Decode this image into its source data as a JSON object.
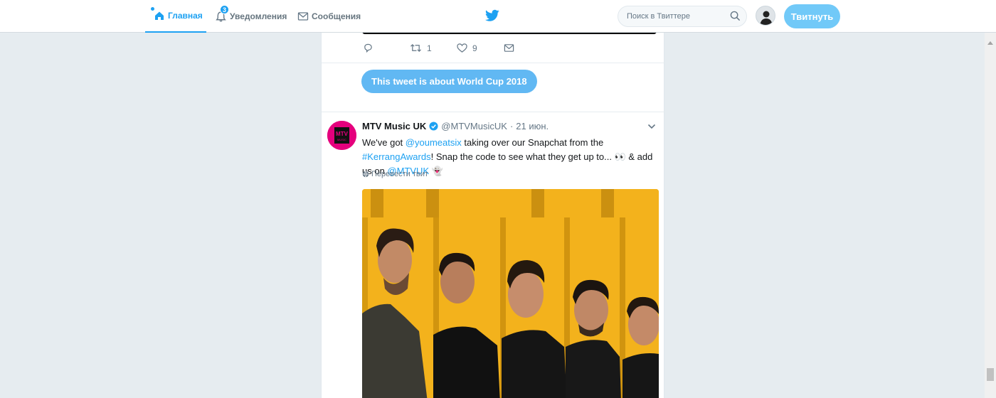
{
  "nav": {
    "home_label": "Главная",
    "notifications_label": "Уведомления",
    "notifications_count": "3",
    "messages_label": "Сообщения"
  },
  "search": {
    "placeholder": "Поиск в Твиттере"
  },
  "tweet_button_label": "Твитнуть",
  "prev_tweet": {
    "retweets": "1",
    "likes": "9",
    "topic_label": "This tweet is about World Cup 2018"
  },
  "tweet": {
    "author": "MTV Music UK",
    "handle": "@MTVMusicUK",
    "separator": "·",
    "date": "21 июн.",
    "text": {
      "p1": "We've got ",
      "mention1": "@youmeatsix",
      "p2": " taking over our Snapchat from the ",
      "hashtag": "#KerrangAwards",
      "p3": "! Snap the code to see what they get up to... 👀 & add us on ",
      "mention2": "@MTVUK",
      "p4": " 👻"
    },
    "translate_label": "Перевести твит",
    "avatar_logo_text": "MTV",
    "avatar_sub_text": "MUSIC"
  },
  "colors": {
    "accent": "#1da1f2",
    "media_bg": "#f3b21c",
    "avatar_bg": "#e5007d"
  }
}
